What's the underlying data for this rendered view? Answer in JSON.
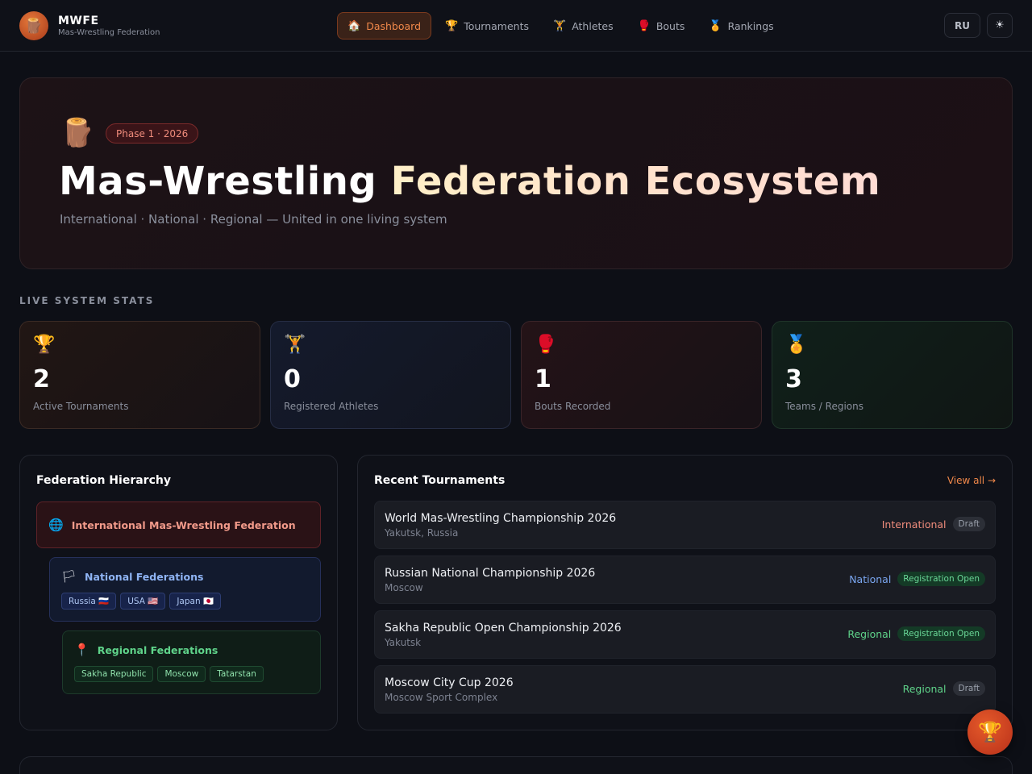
{
  "header": {
    "logo_icon": "🪵",
    "brand_name": "MWFE",
    "brand_sub": "Mas-Wrestling Federation",
    "nav": [
      {
        "icon": "🏠",
        "label": "Dashboard",
        "active": true
      },
      {
        "icon": "🏆",
        "label": "Tournaments"
      },
      {
        "icon": "🏋",
        "label": "Athletes"
      },
      {
        "icon": "🥊",
        "label": "Bouts"
      },
      {
        "icon": "🏅",
        "label": "Rankings"
      }
    ],
    "lang": "RU",
    "theme_icon": "☀"
  },
  "hero": {
    "icon": "🪵",
    "badge": "Phase 1 · 2026",
    "title_plain": "Mas-Wrestling",
    "title_highlight": "Federation Ecosystem",
    "subtitle": "International · National · Regional — United in one living system"
  },
  "stats": {
    "section_label": "LIVE SYSTEM STATS",
    "items": [
      {
        "icon": "🏆",
        "value": "2",
        "label": "Active Tournaments"
      },
      {
        "icon": "🏋",
        "value": "0",
        "label": "Registered Athletes"
      },
      {
        "icon": "🥊",
        "value": "1",
        "label": "Bouts Recorded"
      },
      {
        "icon": "🏅",
        "value": "3",
        "label": "Teams / Regions"
      }
    ]
  },
  "hierarchy": {
    "title": "Federation Hierarchy",
    "international": {
      "icon": "🌐",
      "name": "International Mas-Wrestling Federation"
    },
    "national": {
      "icon": "🏳",
      "name": "National Federations",
      "chips": [
        "Russia 🇷🇺",
        "USA 🇺🇸",
        "Japan 🇯🇵"
      ]
    },
    "regional": {
      "icon": "📍",
      "name": "Regional Federations",
      "chips": [
        "Sakha Republic",
        "Moscow",
        "Tatarstan"
      ]
    }
  },
  "tournaments": {
    "title": "Recent Tournaments",
    "view_all": "View all →",
    "items": [
      {
        "name": "World Mas-Wrestling Championship 2026",
        "location": "Yakutsk, Russia",
        "level": "International",
        "status": "Draft"
      },
      {
        "name": "Russian National Championship 2026",
        "location": "Moscow",
        "level": "National",
        "status": "Registration Open"
      },
      {
        "name": "Sakha Republic Open Championship 2026",
        "location": "Yakutsk",
        "level": "Regional",
        "status": "Registration Open"
      },
      {
        "name": "Moscow City Cup 2026",
        "location": "Moscow Sport Complex",
        "level": "Regional",
        "status": "Draft"
      }
    ]
  },
  "fab_icon": "🏆"
}
